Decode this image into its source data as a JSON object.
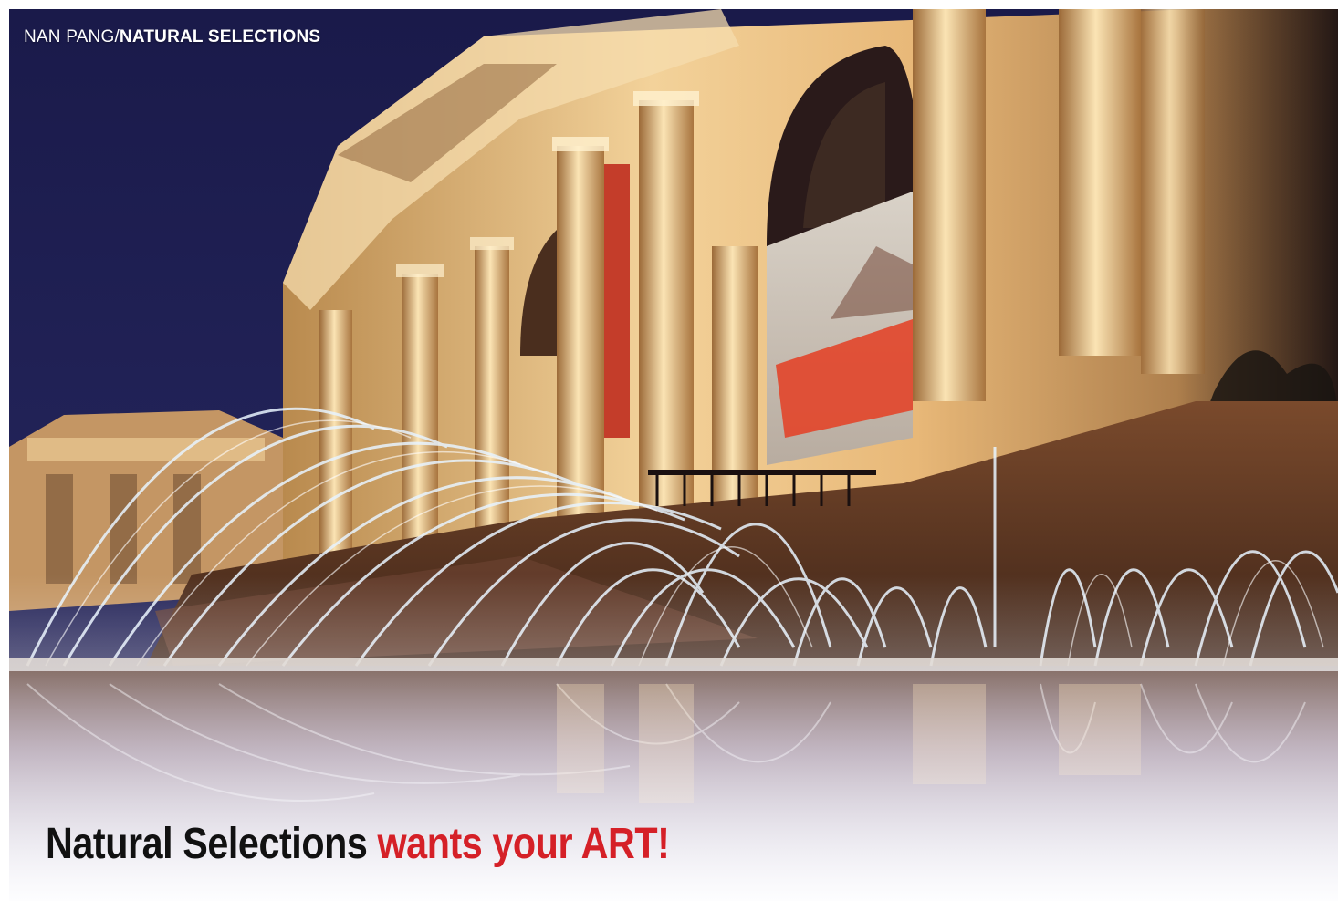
{
  "photo": {
    "subject": "museum-facade-with-fountains-at-night"
  },
  "credit": {
    "author": "NAN PANG",
    "separator": "/",
    "publication": "NATURAL SELECTIONS"
  },
  "headline": {
    "lead": "Natural Selections",
    "accent": "wants your ART!"
  },
  "colors": {
    "accent": "#d52027",
    "headline_text": "#111111",
    "credit_text": "#ffffff",
    "night_sky": "#14163a"
  }
}
